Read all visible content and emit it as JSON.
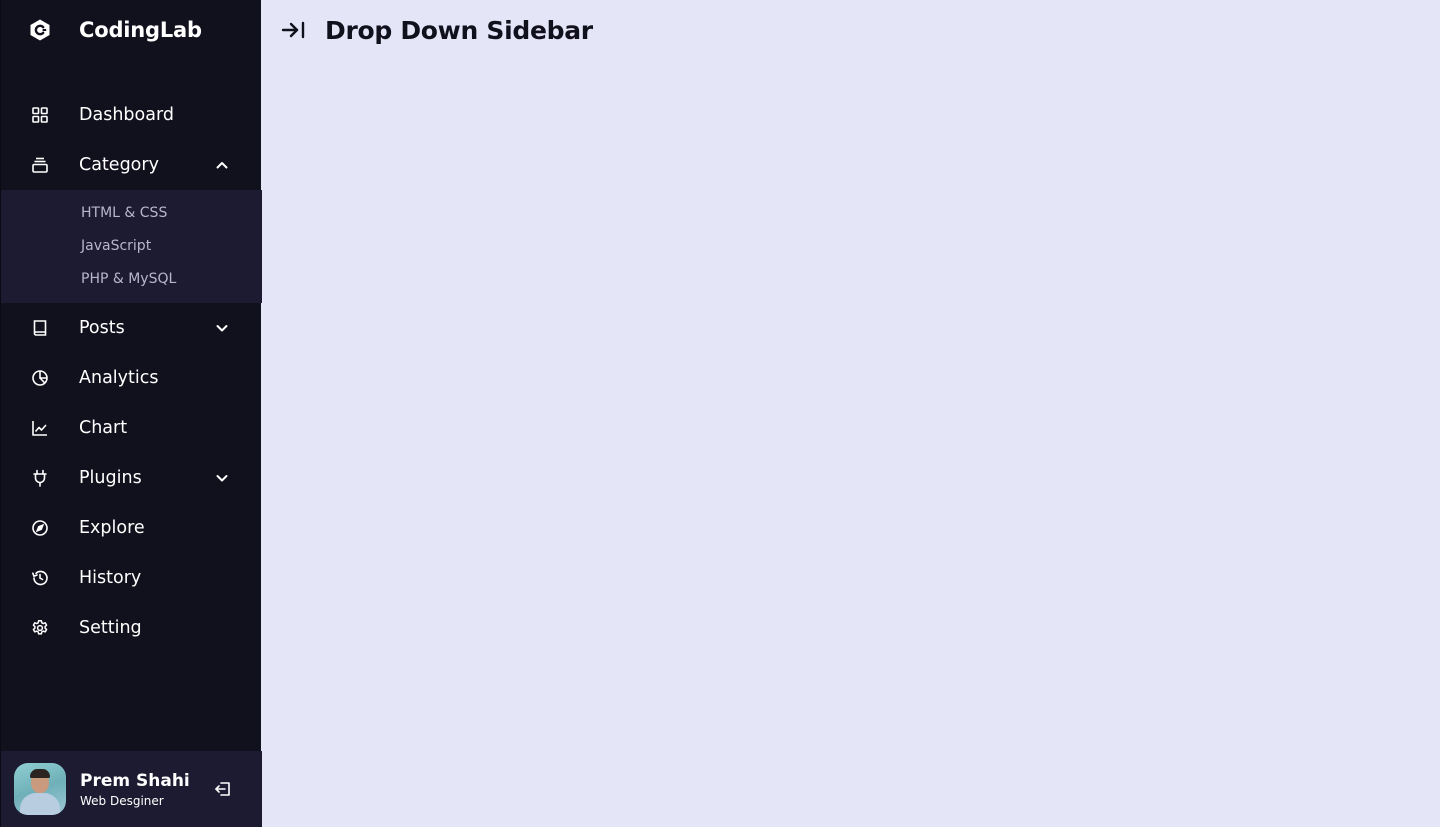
{
  "brand": {
    "name": "CodingLab"
  },
  "header": {
    "title": "Drop Down Sidebar"
  },
  "sidebar": {
    "items": [
      {
        "label": "Dashboard",
        "icon": "grid-icon"
      },
      {
        "label": "Category",
        "icon": "collection-icon",
        "expanded": true,
        "submenu": [
          "HTML & CSS",
          "JavaScript",
          "PHP & MySQL"
        ]
      },
      {
        "label": "Posts",
        "icon": "book-icon",
        "expanded": false
      },
      {
        "label": "Analytics",
        "icon": "pie-chart-icon"
      },
      {
        "label": "Chart",
        "icon": "line-chart-icon"
      },
      {
        "label": "Plugins",
        "icon": "plug-icon",
        "expanded": false
      },
      {
        "label": "Explore",
        "icon": "compass-icon"
      },
      {
        "label": "History",
        "icon": "history-icon"
      },
      {
        "label": "Setting",
        "icon": "gear-icon"
      }
    ]
  },
  "profile": {
    "name": "Prem Shahi",
    "job": "Web Desginer"
  },
  "colors": {
    "sidebar_bg": "#11101d",
    "submenu_bg": "#1d1b31",
    "main_bg": "#e4e5f7",
    "text_light": "#ffffff",
    "submenu_text": "#b9b6c9"
  }
}
